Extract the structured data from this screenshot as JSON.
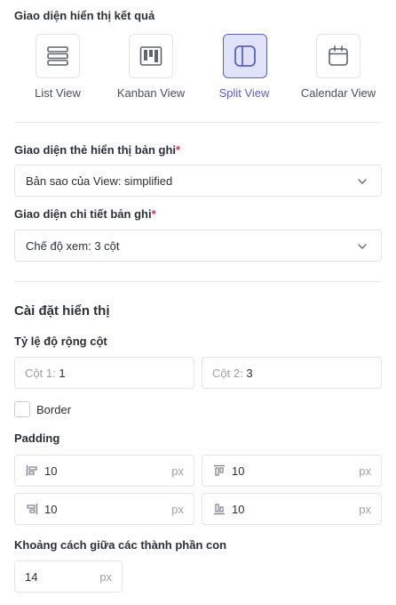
{
  "result_view": {
    "title": "Giao diện hiển thị kết quả",
    "options": [
      {
        "label": "List View",
        "icon": "list-icon",
        "active": false
      },
      {
        "label": "Kanban View",
        "icon": "kanban-icon",
        "active": false
      },
      {
        "label": "Split View",
        "icon": "split-view-icon",
        "active": true
      },
      {
        "label": "Calendar View",
        "icon": "calendar-icon",
        "active": false
      }
    ]
  },
  "record_card": {
    "label": "Giao diện thẻ hiển thị bản ghi",
    "required_mark": "*",
    "value": "Bản sao của View: simplified"
  },
  "record_detail": {
    "label": "Giao diện chi tiết bản ghi",
    "required_mark": "*",
    "value": "Chế độ xem: 3 cột"
  },
  "display_settings": {
    "title": "Cài đặt hiển thị",
    "column_ratio": {
      "label": "Tỷ lệ độ rộng cột",
      "col1_prefix": "Cột 1:",
      "col1_value": "1",
      "col2_prefix": "Cột 2:",
      "col2_value": "3"
    },
    "border": {
      "label": "Border",
      "checked": false
    },
    "padding": {
      "label": "Padding",
      "left": {
        "value": "10",
        "unit": "px",
        "icon": "padding-left-icon"
      },
      "top": {
        "value": "10",
        "unit": "px",
        "icon": "padding-top-icon"
      },
      "right": {
        "value": "10",
        "unit": "px",
        "icon": "padding-right-icon"
      },
      "bottom": {
        "value": "10",
        "unit": "px",
        "icon": "padding-bottom-icon"
      }
    },
    "gap": {
      "label": "Khoảng cách giữa các thành phần con",
      "value": "14",
      "unit": "px"
    }
  },
  "colors": {
    "accent": "#5a62c9",
    "accent_bg": "#dfe2f8",
    "required": "#d8304a",
    "border": "#e2e4ea"
  }
}
